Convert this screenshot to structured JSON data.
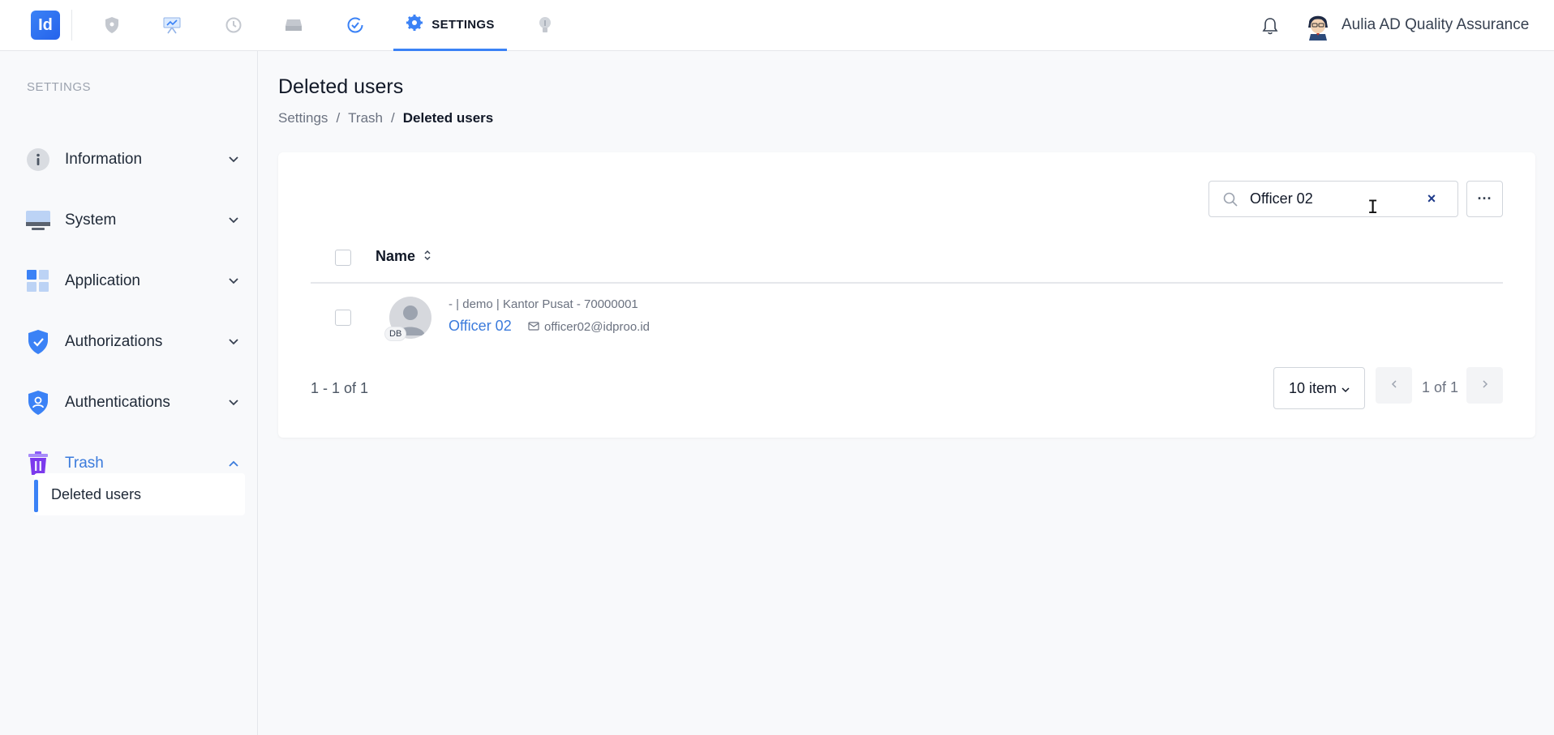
{
  "app": {
    "logo_text": "Id",
    "nav_icons": [
      "shield-icon",
      "presentation-icon",
      "history-icon",
      "storage-icon",
      "check-circle-icon",
      "bulb-icon"
    ],
    "active_tab": "SETTINGS",
    "user_name": "Aulia AD Quality Assurance",
    "accent_color": "#3b82f6"
  },
  "sidebar": {
    "heading": "SETTINGS",
    "items": [
      {
        "label": "Information",
        "icon": "info-icon",
        "expanded": false
      },
      {
        "label": "System",
        "icon": "monitor-icon",
        "expanded": false
      },
      {
        "label": "Application",
        "icon": "grid-icon",
        "expanded": false
      },
      {
        "label": "Authorizations",
        "icon": "shield-check-icon",
        "expanded": false
      },
      {
        "label": "Authentications",
        "icon": "shield-user-icon",
        "expanded": false
      },
      {
        "label": "Trash",
        "icon": "trash-icon",
        "expanded": true
      }
    ],
    "sub_item": "Deleted users"
  },
  "page": {
    "title": "Deleted users",
    "breadcrumb": [
      "Settings",
      "Trash",
      "Deleted users"
    ],
    "breadcrumb_sep": "/"
  },
  "search": {
    "value": "Officer 02",
    "clear": "×",
    "more": "···"
  },
  "table": {
    "column_name": "Name",
    "rows": [
      {
        "meta": "- | demo | Kantor Pusat - 70000001",
        "name": "Officer 02",
        "email": "officer02@idproo.id",
        "badge": "DB"
      }
    ]
  },
  "pagination": {
    "range": "1 - 1 of 1",
    "per_page": "10 item",
    "page_text": "1 of 1"
  }
}
